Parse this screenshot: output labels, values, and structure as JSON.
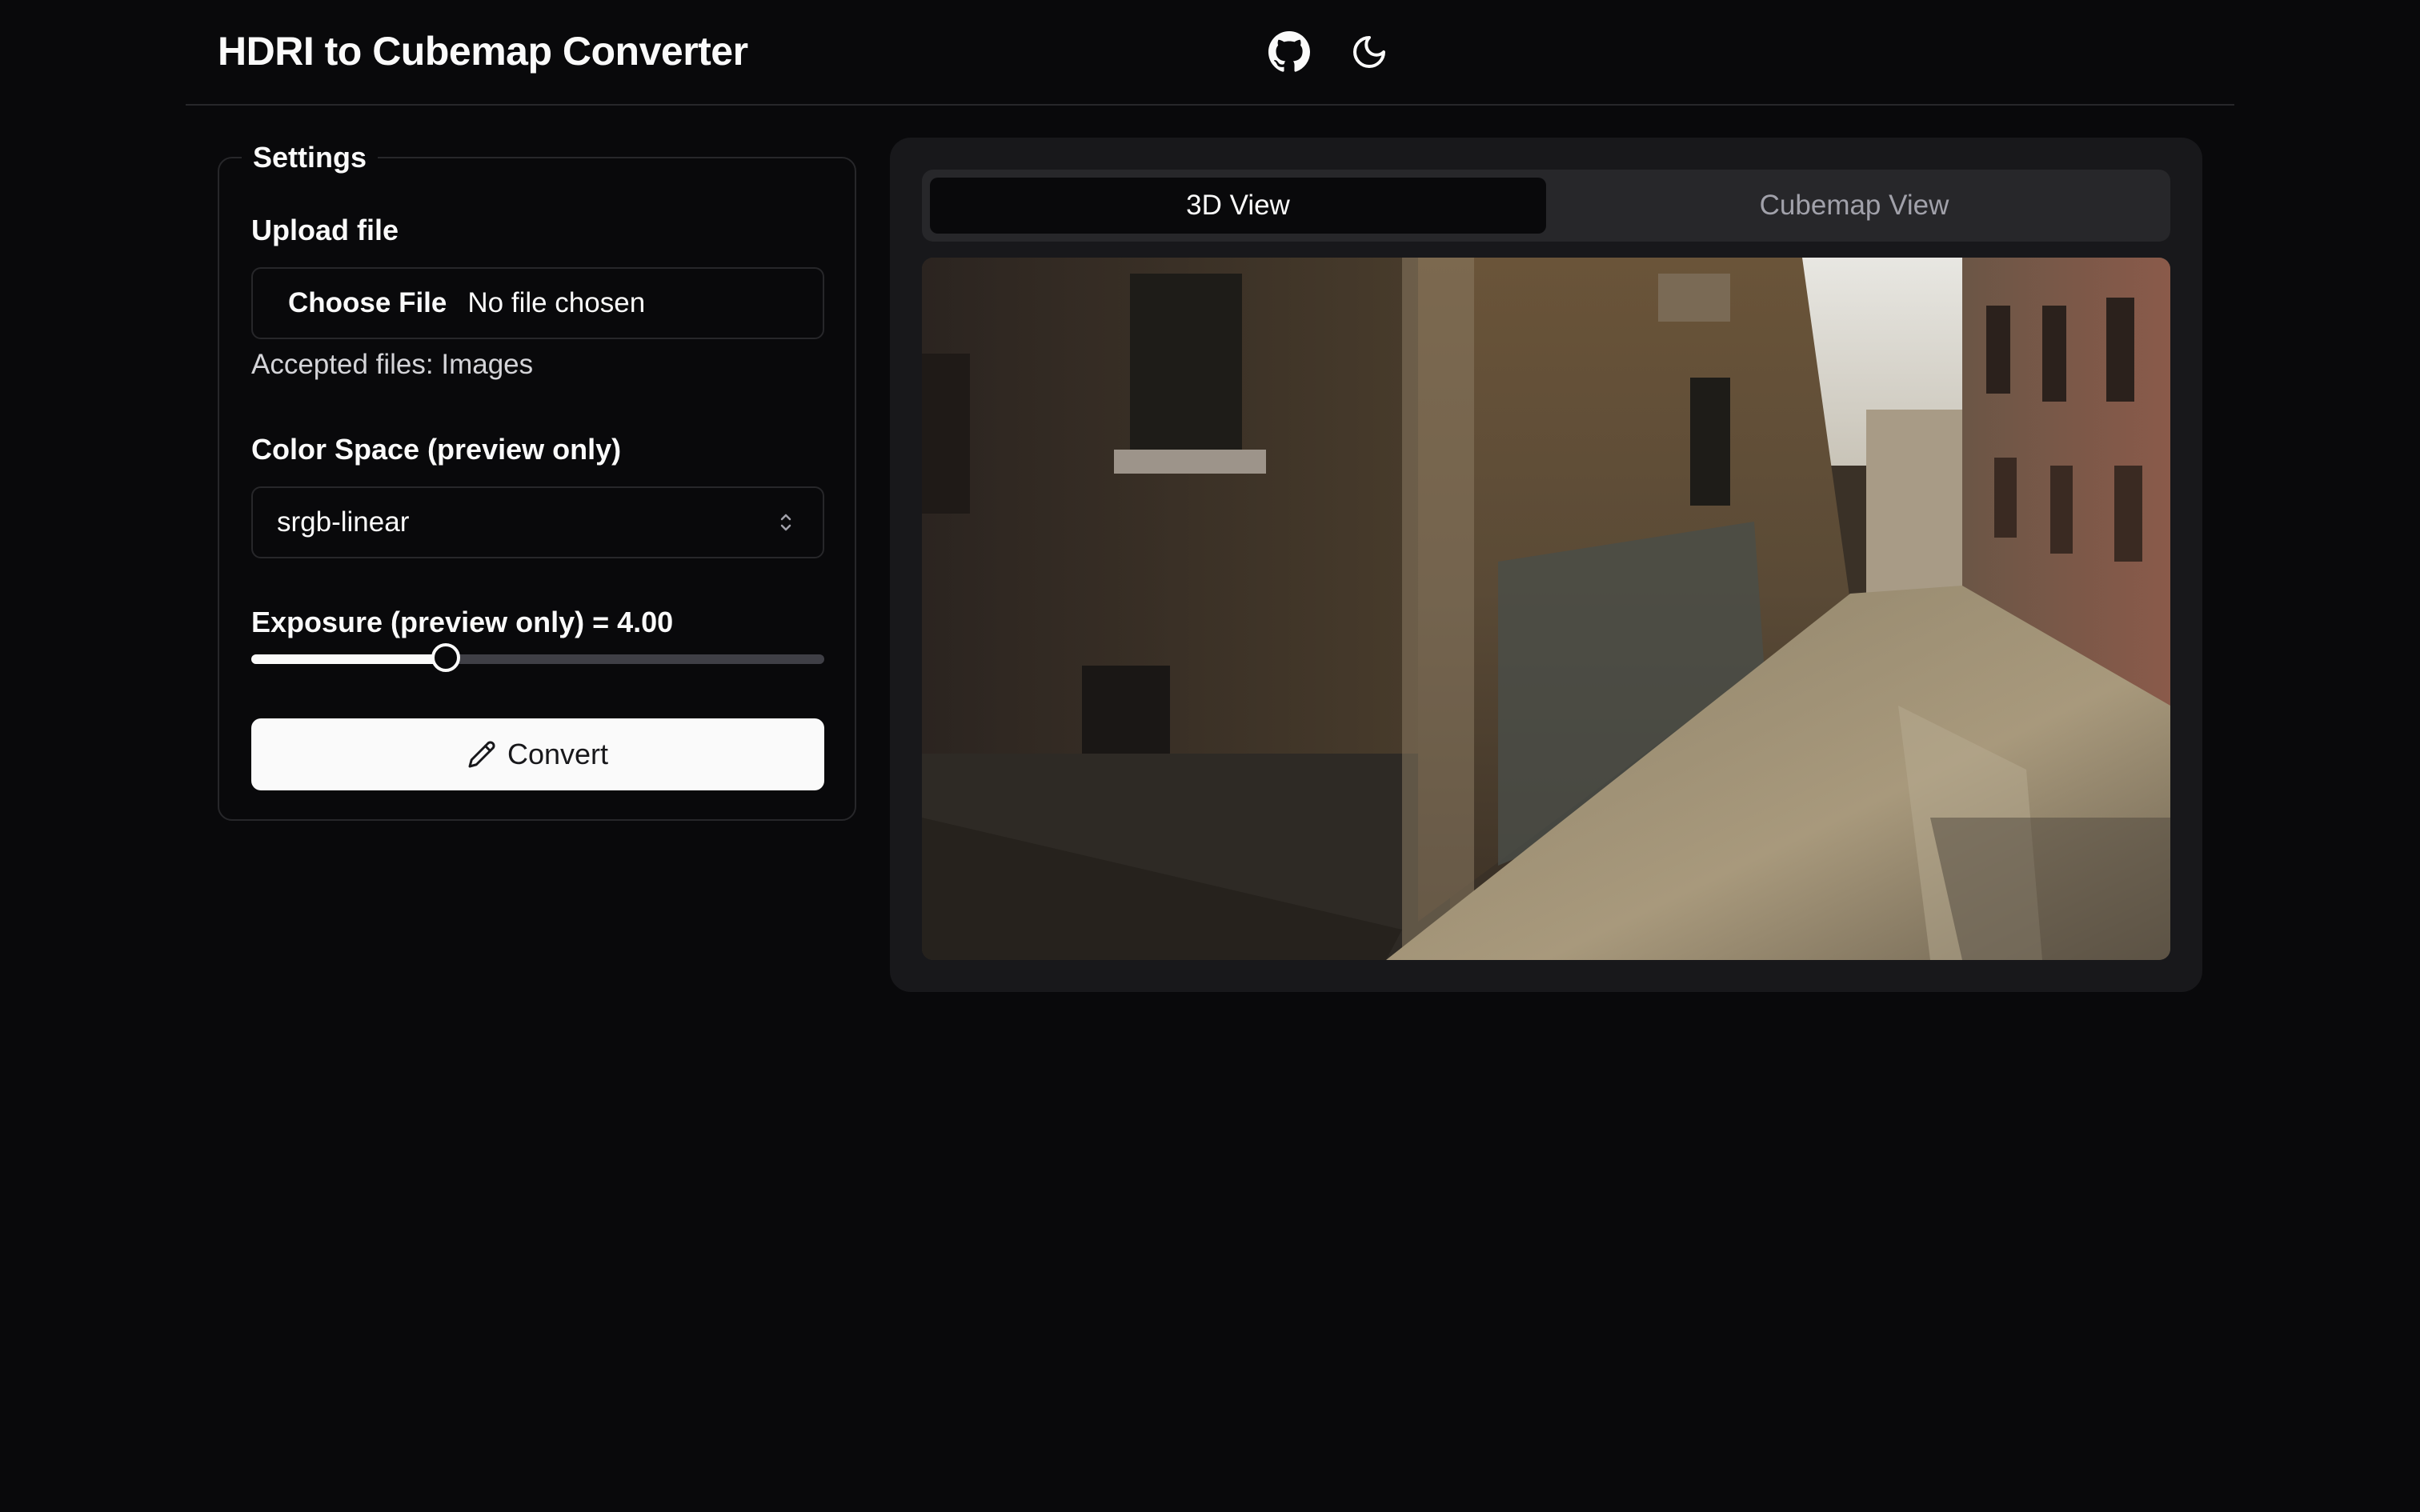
{
  "header": {
    "title": "HDRI to Cubemap Converter",
    "icons": [
      "github-icon",
      "moon-icon"
    ]
  },
  "settings": {
    "legend": "Settings",
    "upload": {
      "label": "Upload file",
      "button_label": "Choose File",
      "status": "No file chosen",
      "helper": "Accepted files: Images"
    },
    "color_space": {
      "label": "Color Space (preview only)",
      "value": "srgb-linear",
      "icon": "chevron-up-down-icon"
    },
    "exposure": {
      "label": "Exposure (preview only) = 4.00",
      "level_fraction": 0.34
    },
    "convert": {
      "label": "Convert",
      "icon": "pencil-icon"
    }
  },
  "preview": {
    "tabs": [
      {
        "label": "3D View",
        "active": true
      },
      {
        "label": "Cubemap View",
        "active": false
      }
    ]
  },
  "colors": {
    "background": "#09090b",
    "panel": "#18181b",
    "border": "#27272a",
    "text": "#fafafa",
    "muted": "#a1a1aa"
  }
}
